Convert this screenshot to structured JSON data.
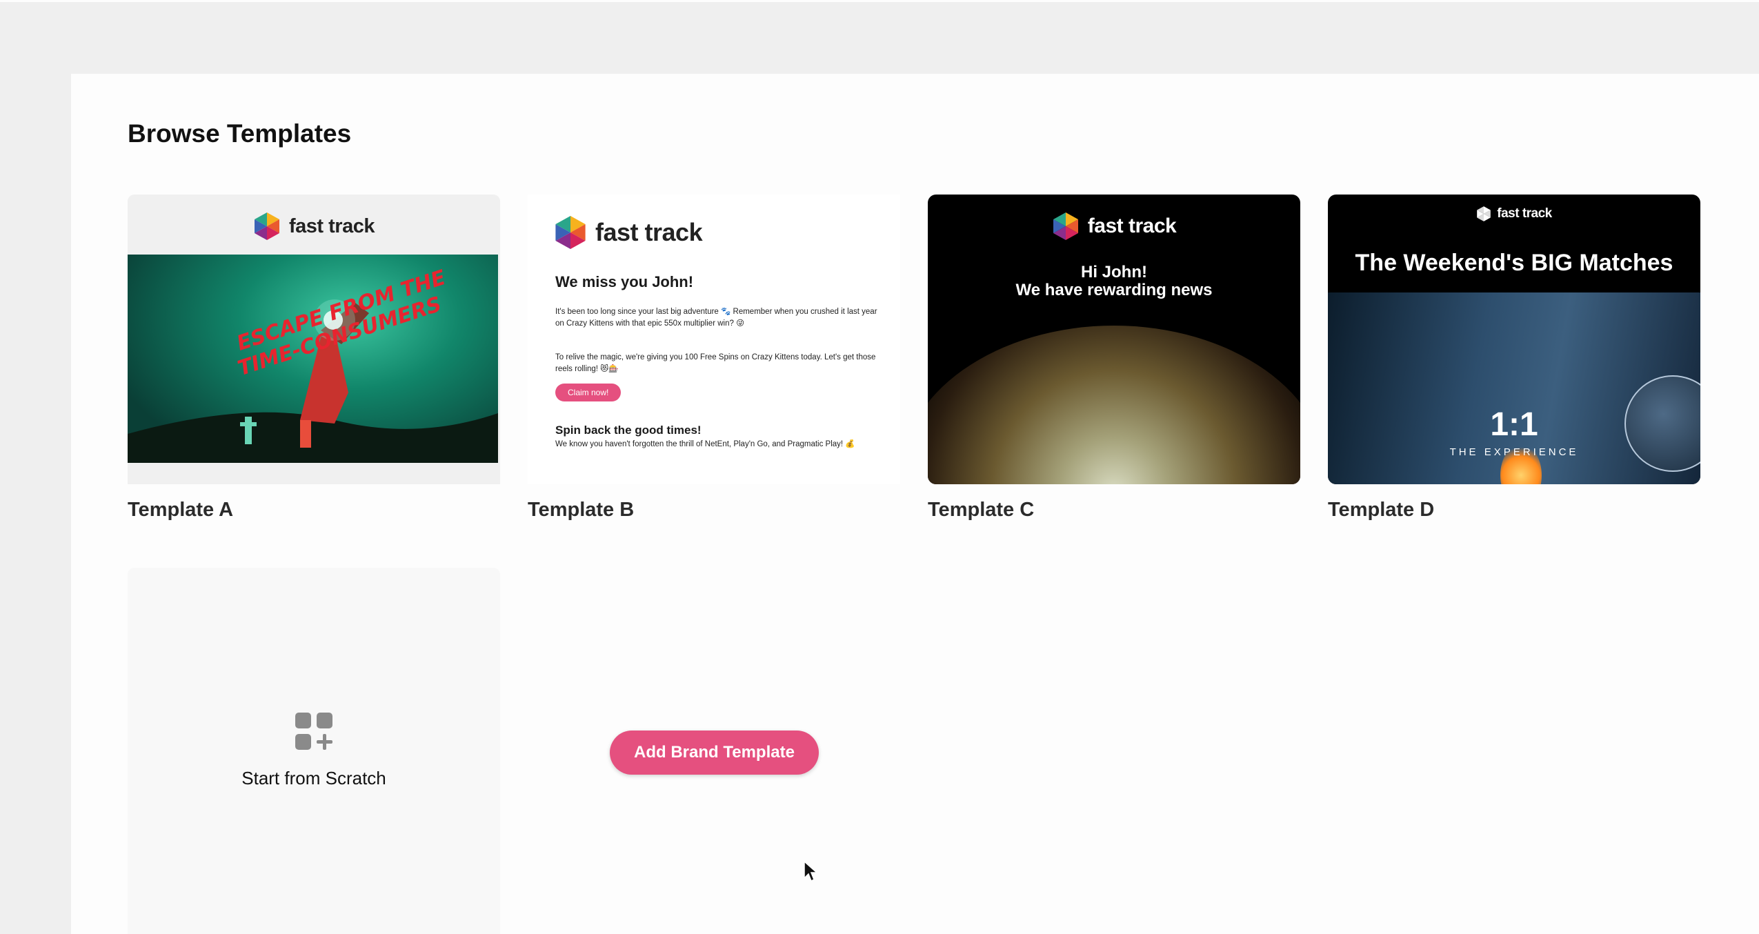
{
  "page": {
    "title": "Browse Templates"
  },
  "templates": [
    {
      "label": "Template A",
      "logo_text": "fast track",
      "art_text": "ESCAPE FROM THE TIME-CONSUMERS"
    },
    {
      "label": "Template B",
      "logo_text": "fast track",
      "headline": "We miss you John!",
      "paragraph1": "It's been too long since your last big adventure 🐾 Remember when you crushed it last year on Crazy Kittens with that epic 550x multiplier win? 😜",
      "paragraph2": "To relive the magic, we're giving you 100 Free Spins on Crazy Kittens today. Let's get those reels rolling! 😻🎰",
      "button": "Claim now!",
      "subheadline": "Spin back the good times!",
      "paragraph3": "We know you haven't forgotten the thrill of NetEnt, Play'n Go, and Pragmatic Play! 💰"
    },
    {
      "label": "Template C",
      "logo_text": "fast track",
      "headline_line1": "Hi John!",
      "headline_line2": "We have rewarding news"
    },
    {
      "label": "Template D",
      "logo_text": "fast track",
      "headline": "The Weekend's BIG Matches",
      "number_text": "1:1",
      "subtitle": "THE EXPERIENCE"
    }
  ],
  "scratch": {
    "label": "Start from Scratch",
    "icon": "grid-plus-icon"
  },
  "actions": {
    "add_brand_template": "Add Brand Template"
  },
  "colors": {
    "accent": "#e5507f",
    "panel": "#fdfdfd",
    "background": "#efefef"
  }
}
